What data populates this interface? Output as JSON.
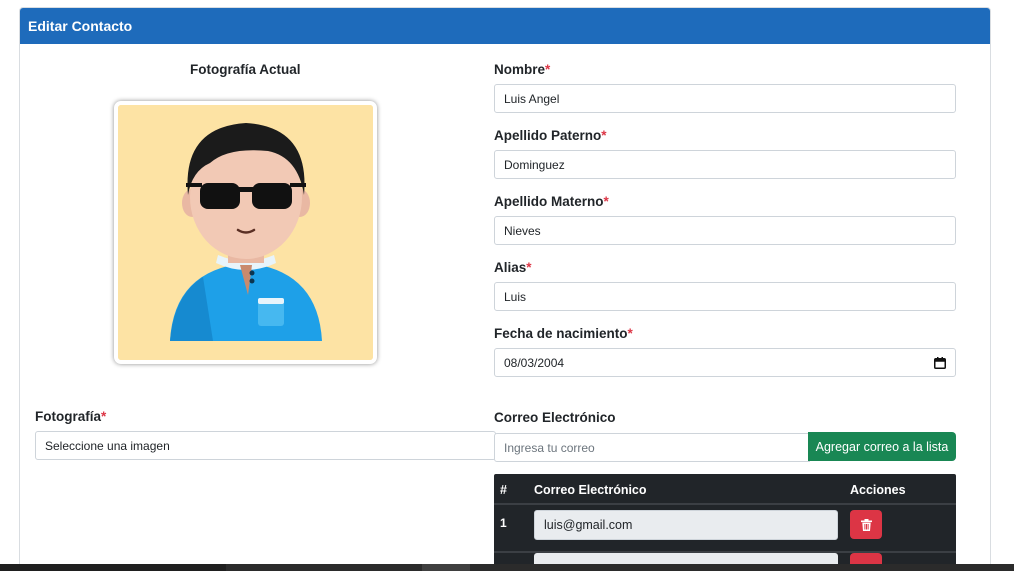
{
  "card": {
    "title": "Editar Contacto"
  },
  "photo": {
    "title": "Fotografía Actual"
  },
  "form": {
    "nombre": {
      "label": "Nombre",
      "required": "*",
      "value": "Luis Angel"
    },
    "apellido_paterno": {
      "label": "Apellido Paterno",
      "required": "*",
      "value": "Dominguez"
    },
    "apellido_materno": {
      "label": "Apellido Materno",
      "required": "*",
      "value": "Nieves"
    },
    "alias": {
      "label": "Alias",
      "required": "*",
      "value": "Luis"
    },
    "fecha_nacimiento": {
      "label": "Fecha de nacimiento",
      "required": "*",
      "value": "08/03/2004"
    },
    "fotografia": {
      "label": "Fotografía",
      "required": "*",
      "value": "Seleccione una imagen"
    }
  },
  "email_section": {
    "label": "Correo Electrónico",
    "input_placeholder": "Ingresa tu correo",
    "add_button": "Agregar correo a la lista",
    "table": {
      "headers": [
        "#",
        "Correo Electrónico",
        "Acciones"
      ],
      "rows": [
        {
          "num": "1",
          "email": "luis@gmail.com"
        }
      ]
    }
  },
  "colors": {
    "header": "#1e6bbb",
    "success": "#198754",
    "danger": "#dc3545",
    "table_dark": "#212529",
    "photo_bg": "#fde3a4"
  },
  "icons": {
    "delete": "trash-icon",
    "calendar": "calendar-icon"
  }
}
